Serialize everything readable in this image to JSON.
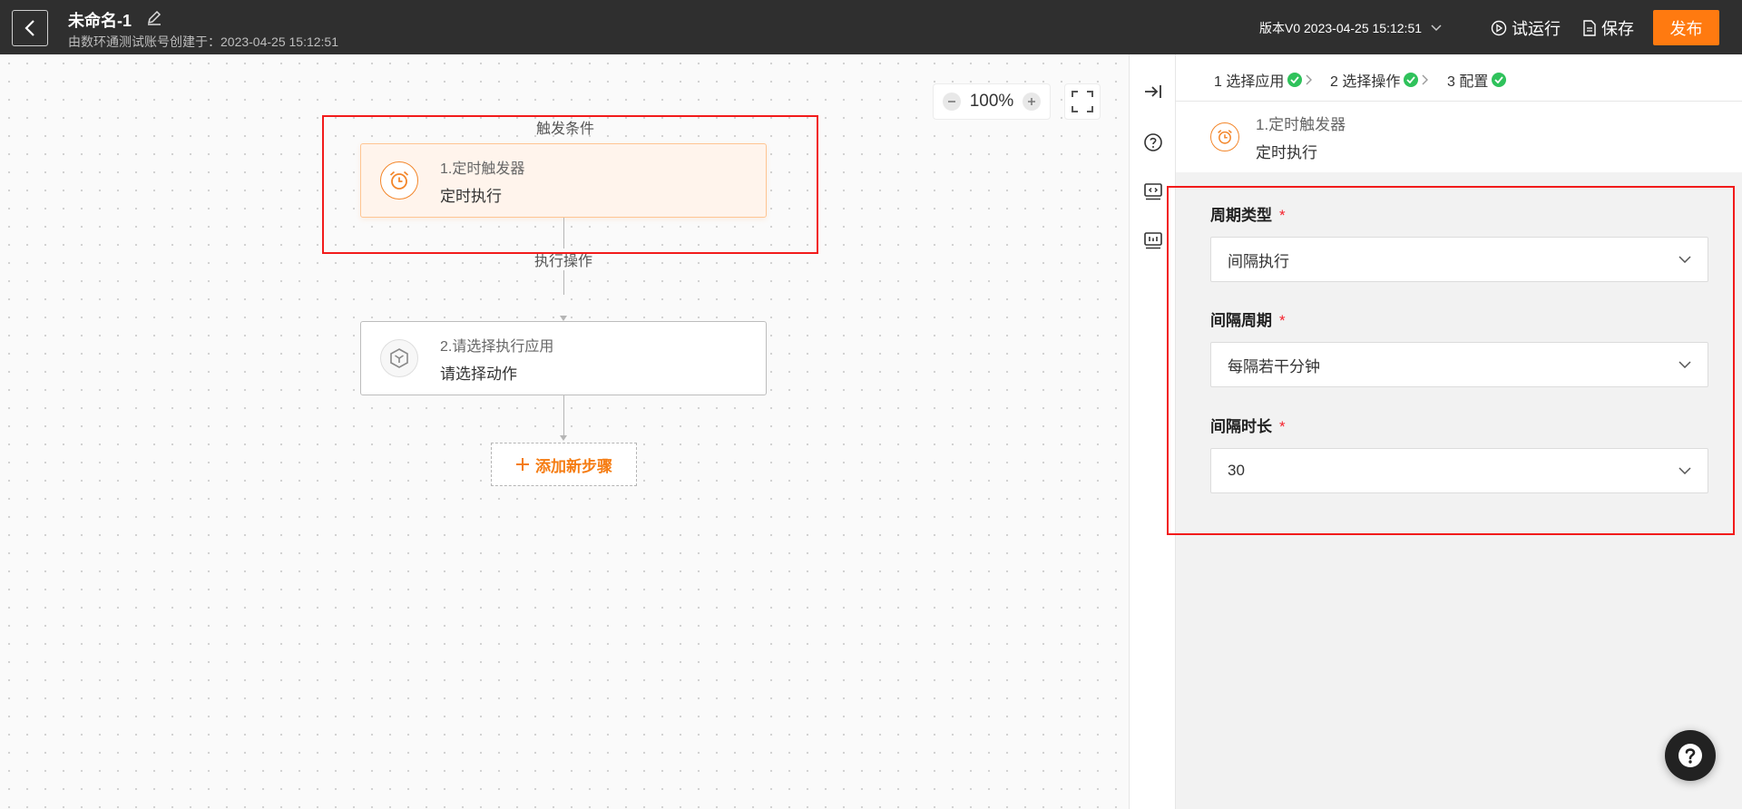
{
  "header": {
    "title": "未命名-1",
    "subtitle": "由数环通测试账号创建于：2023-04-25 15:12:51",
    "version": "版本V0 2023-04-25 15:12:51",
    "run_label": "试运行",
    "save_label": "保存",
    "publish_label": "发布"
  },
  "canvas": {
    "zoom": "100%",
    "trigger_section": "触发条件",
    "action_section": "执行操作",
    "nodes": [
      {
        "title": "1.定时触发器",
        "desc": "定时执行",
        "icon": "alarm-clock-icon"
      },
      {
        "title": "2.请选择执行应用",
        "desc": "请选择动作",
        "icon": "app-cube-icon"
      }
    ],
    "add_step_label": "添加新步骤"
  },
  "panel": {
    "steps": [
      "1 选择应用",
      "2 选择操作",
      "3 配置"
    ],
    "summary": {
      "title": "1.定时触发器",
      "desc": "定时执行"
    },
    "fields": [
      {
        "label": "周期类型",
        "value": "间隔执行"
      },
      {
        "label": "间隔周期",
        "value": "每隔若干分钟"
      },
      {
        "label": "间隔时长",
        "value": "30"
      }
    ]
  },
  "colors": {
    "header_bg": "#2f2f2f",
    "accent": "#ff7a10",
    "success": "#2fc25b",
    "highlight": "#f21b1b"
  }
}
